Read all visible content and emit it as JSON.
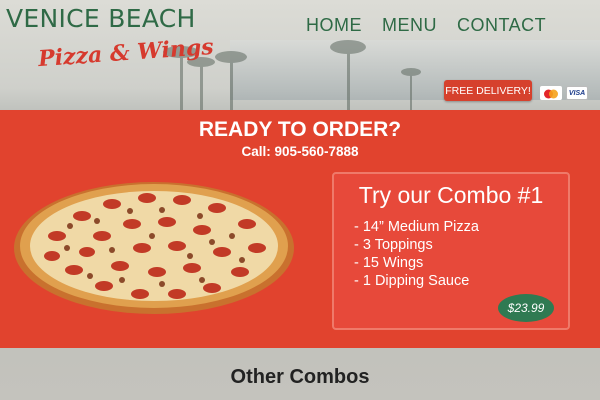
{
  "brand": {
    "name": "VENICE BEACH",
    "tagline": "Pizza & Wings"
  },
  "nav": {
    "items": [
      {
        "label": "HOME"
      },
      {
        "label": "MENU"
      },
      {
        "label": "CONTACT"
      }
    ]
  },
  "header": {
    "delivery_label": "FREE DELIVERY!",
    "card_visa": "VISA",
    "payment_icons": [
      "mastercard-icon",
      "visa-icon"
    ]
  },
  "hero": {
    "headline": "READY TO ORDER?",
    "call": "Call: 905-560-7888",
    "combo": {
      "title": "Try our Combo #1",
      "items": [
        "- 14” Medium Pizza",
        "- 3 Toppings",
        "- 15 Wings",
        "- 1 Dipping Sauce"
      ],
      "price": "$23.99"
    }
  },
  "section": {
    "heading": "Other Combos"
  },
  "colors": {
    "brand_green": "#2f6a46",
    "brand_red": "#d63a2e",
    "hero_red": "#e1432e",
    "price_green": "#2f7a52"
  }
}
